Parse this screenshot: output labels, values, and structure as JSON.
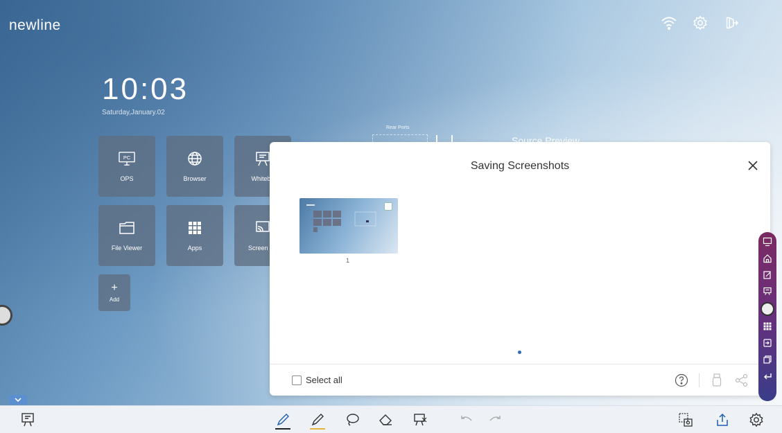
{
  "brand": {
    "logo": "newline"
  },
  "top_icons": [
    "wifi-icon",
    "settings-icon",
    "signout-icon"
  ],
  "clock": {
    "time": "10:03",
    "date": "Saturday,January.02"
  },
  "tiles": [
    {
      "label": "OPS",
      "icon": "pc-icon"
    },
    {
      "label": "Browser",
      "icon": "globe-icon"
    },
    {
      "label": "Whitebo",
      "icon": "whiteboard-icon"
    },
    {
      "label": "File Viewer",
      "icon": "folder-icon"
    },
    {
      "label": "Apps",
      "icon": "apps-grid-icon"
    },
    {
      "label": "Screen Sh",
      "icon": "screen-share-icon"
    },
    {
      "label": "Add",
      "icon": "plus-icon"
    }
  ],
  "background_labels": {
    "rear_ports": "Rear Ports",
    "source_preview": "Source Preview"
  },
  "dialog": {
    "title": "Saving Screenshots",
    "thumbnail_number": "1",
    "select_all_label": "Select all",
    "footer_icons": [
      "help-icon",
      "usb-icon",
      "share-icon"
    ]
  },
  "side_toolbar": [
    "whiteboard-icon",
    "home-icon",
    "annotate-icon",
    "display-icon",
    "handle-icon",
    "apps-icon",
    "input-icon",
    "window-icon",
    "back-icon"
  ],
  "bottom_toolbar": {
    "left": [
      "whiteboard-icon"
    ],
    "center": [
      "pen-icon",
      "highlighter-icon",
      "lasso-icon",
      "eraser-icon",
      "clear-annotation-icon",
      "undo-icon",
      "redo-icon"
    ],
    "right": [
      "screenshot-icon",
      "export-icon",
      "settings-icon"
    ],
    "colors": {
      "pen": "#222222",
      "highlighter": "#e6b43c"
    }
  }
}
